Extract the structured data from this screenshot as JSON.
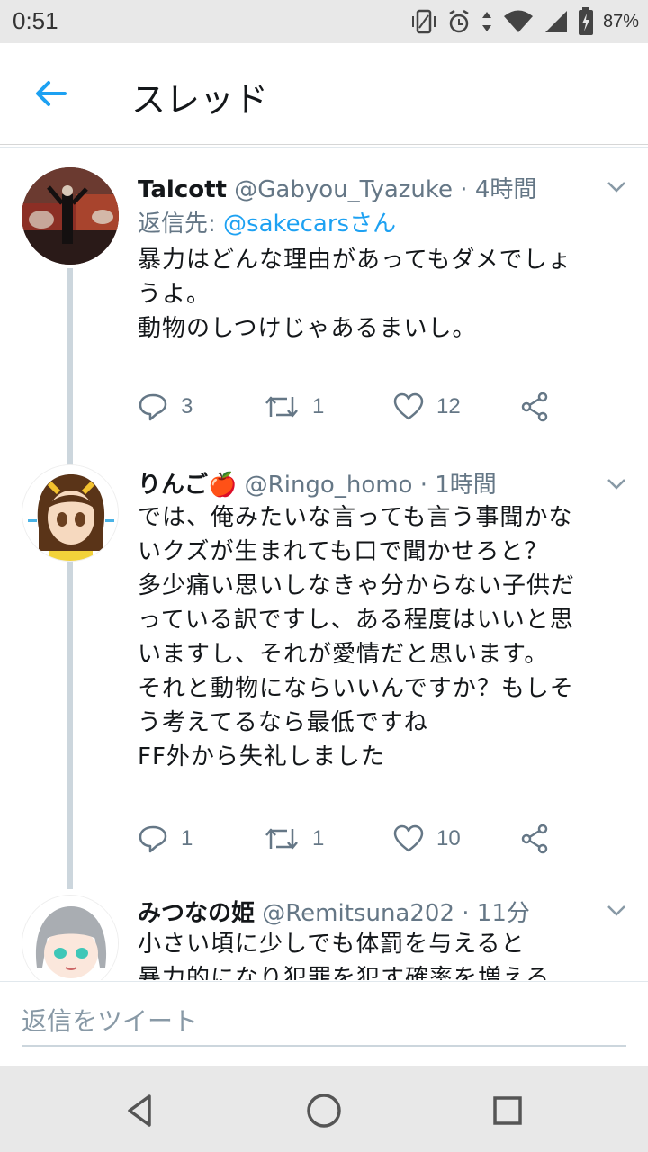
{
  "status_bar": {
    "time": "0:51",
    "battery": "87%",
    "icons": [
      "vibrate-icon",
      "alarm-icon",
      "data-arrows-icon",
      "wifi-icon",
      "signal-icon",
      "battery-charging-icon"
    ]
  },
  "app_bar": {
    "back_icon": "arrow-left-icon",
    "title": "スレッド",
    "accent": "#1da1f2"
  },
  "tweets": [
    {
      "name": "Talcott",
      "handle": "@Gabyou_Tyazuke",
      "dot": "·",
      "time": "4時間",
      "reply_to_prefix": "返信先: ",
      "reply_to_user": "@sakecarsさん",
      "text": "暴力はどんな理由があってもダメでしょ\nうよ。\n動物のしつけじゃあるまいし。",
      "replies": "3",
      "retweets": "1",
      "likes": "12"
    },
    {
      "name": "りんご",
      "name_emoji": "🍎",
      "handle": "@Ringo_homo",
      "dot": "·",
      "time": "1時間",
      "text": "では、俺みたいな言っても言う事聞かな\nいクズが生まれても口で聞かせろと？\n多少痛い思いしなきゃ分からない子供だ\nっている訳ですし、ある程度はいいと思\nいますし、それが愛情だと思います。\nそれと動物にならいいんですか？もしそ\nう考えてるなら最低ですね\nFF外から失礼しました",
      "replies": "1",
      "retweets": "1",
      "likes": "10"
    },
    {
      "name": "みつなの姫",
      "handle": "@Remitsuna202",
      "dot": "·",
      "time": "11分",
      "text": "小さい頃に少しでも体罰を与えると\n暴力的になり犯罪を犯す確率を増える"
    }
  ],
  "compose": {
    "placeholder": "返信をツイート"
  },
  "nav": {
    "icons": [
      "back-triangle-icon",
      "home-circle-icon",
      "recents-square-icon"
    ]
  },
  "colors": {
    "text": "#14171a",
    "secondary": "#657786",
    "link": "#1da1f2",
    "thread_line": "#ccd6dd"
  }
}
